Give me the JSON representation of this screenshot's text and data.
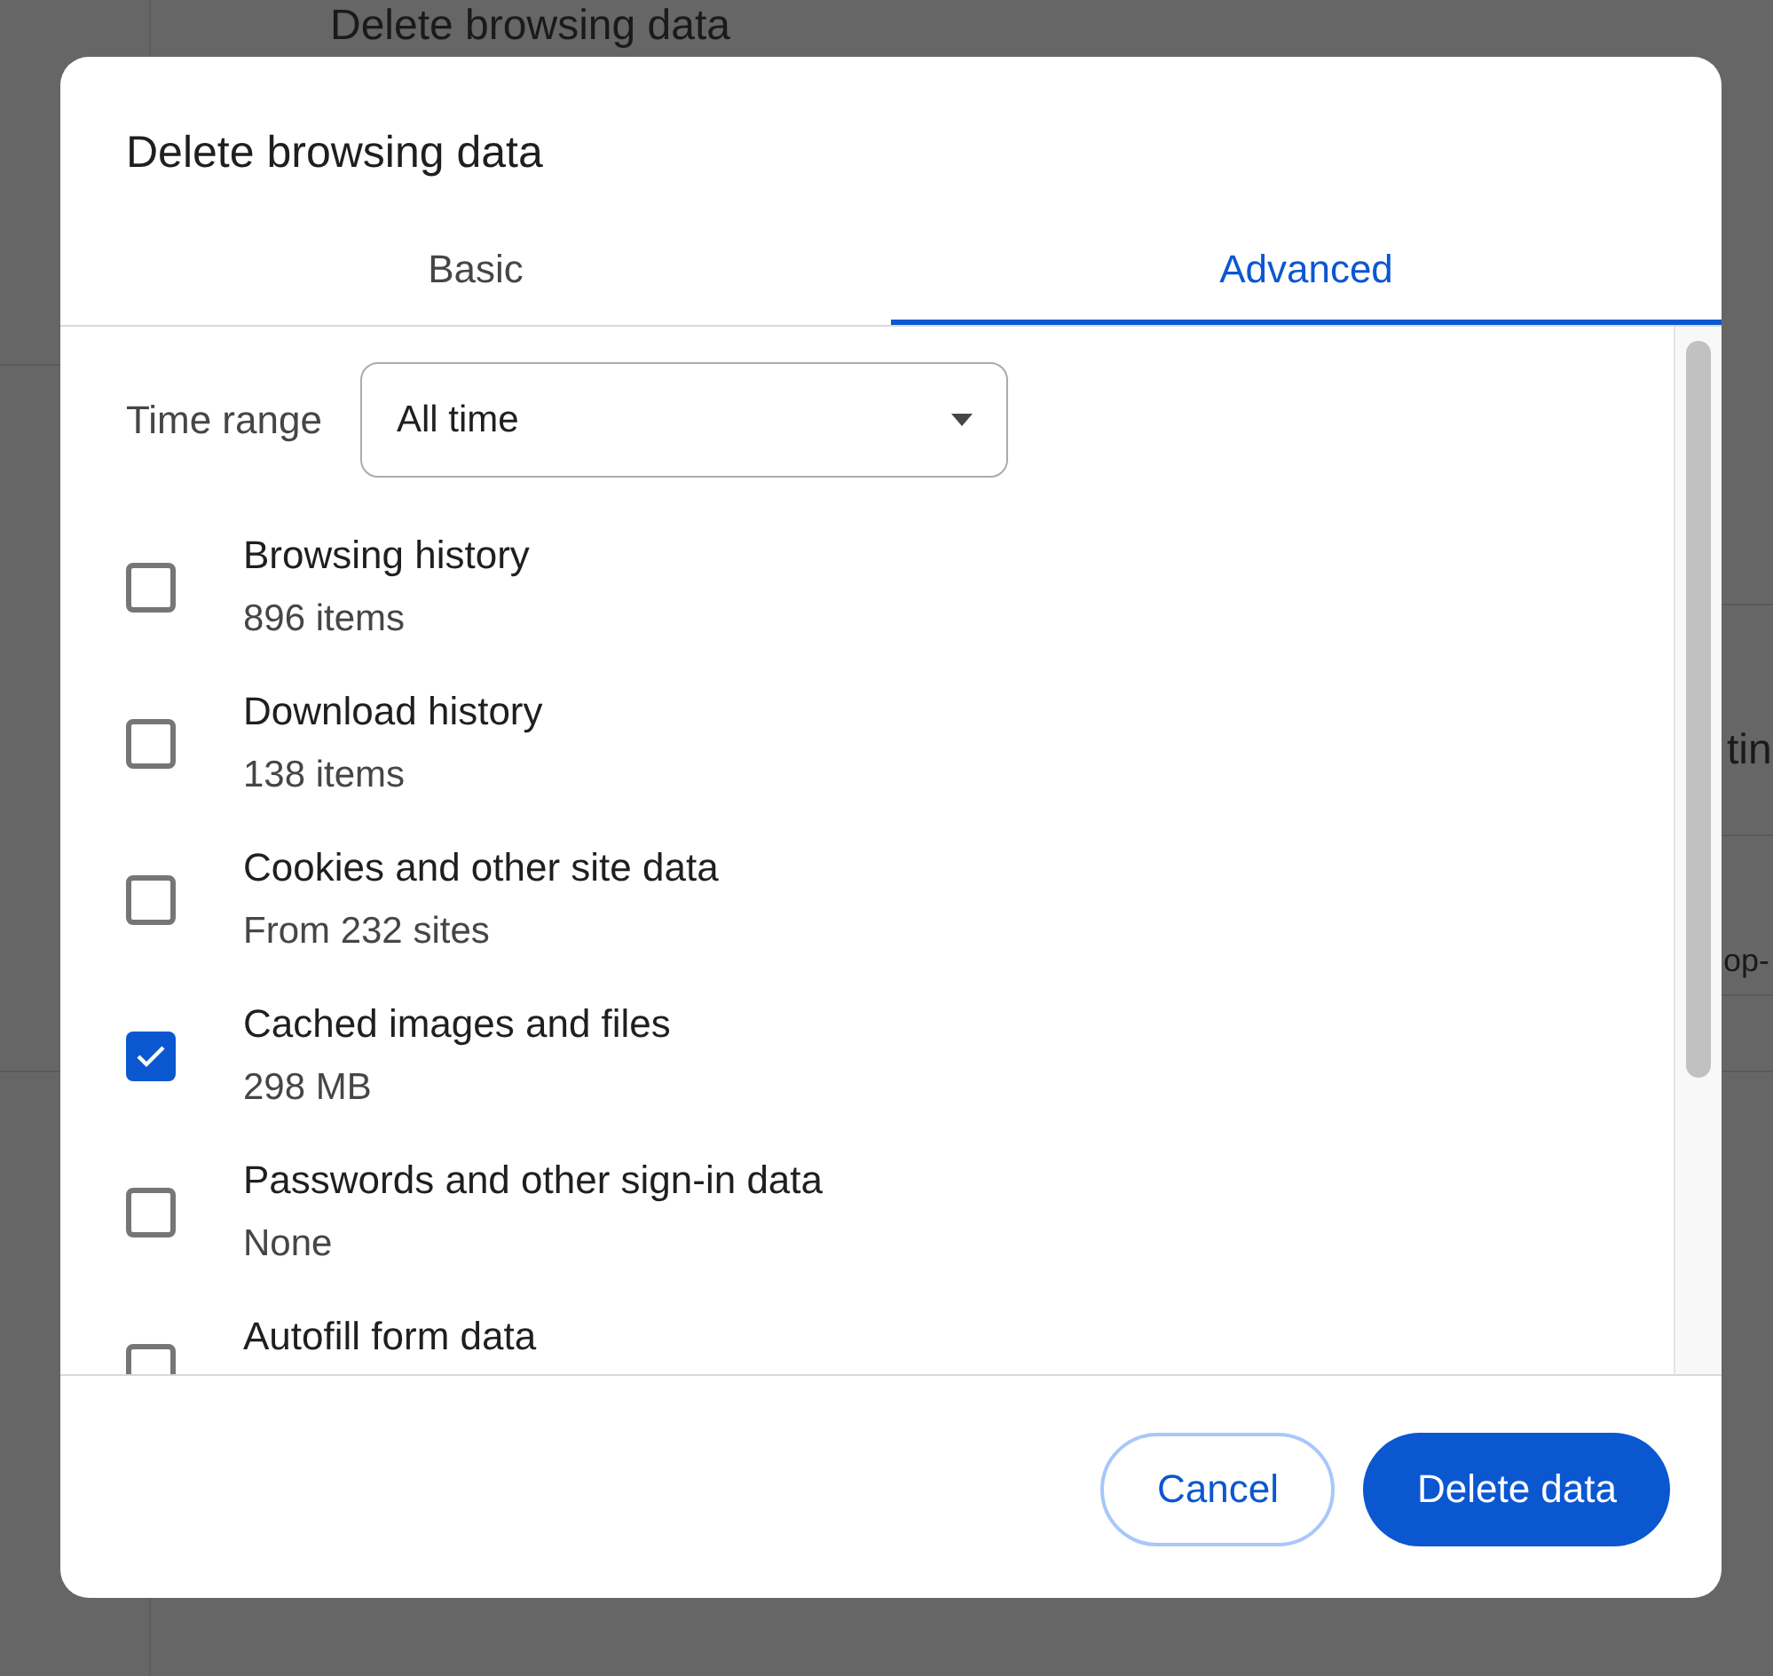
{
  "background": {
    "heading": "Delete browsing data",
    "fragments": [
      "tin",
      "op-"
    ]
  },
  "dialog": {
    "title": "Delete browsing data",
    "tabs": [
      {
        "label": "Basic",
        "selected": false
      },
      {
        "label": "Advanced",
        "selected": true
      }
    ],
    "time_range": {
      "label": "Time range",
      "value": "All time"
    },
    "items": [
      {
        "label": "Browsing history",
        "detail": "896 items",
        "checked": false
      },
      {
        "label": "Download history",
        "detail": "138 items",
        "checked": false
      },
      {
        "label": "Cookies and other site data",
        "detail": "From 232 sites",
        "checked": false
      },
      {
        "label": "Cached images and files",
        "detail": "298 MB",
        "checked": true
      },
      {
        "label": "Passwords and other sign-in data",
        "detail": "None",
        "checked": false
      },
      {
        "label": "Autofill form data",
        "checked": false
      }
    ],
    "buttons": [
      {
        "label": "Cancel",
        "kind": "secondary"
      },
      {
        "label": "Delete data",
        "kind": "primary"
      }
    ]
  }
}
